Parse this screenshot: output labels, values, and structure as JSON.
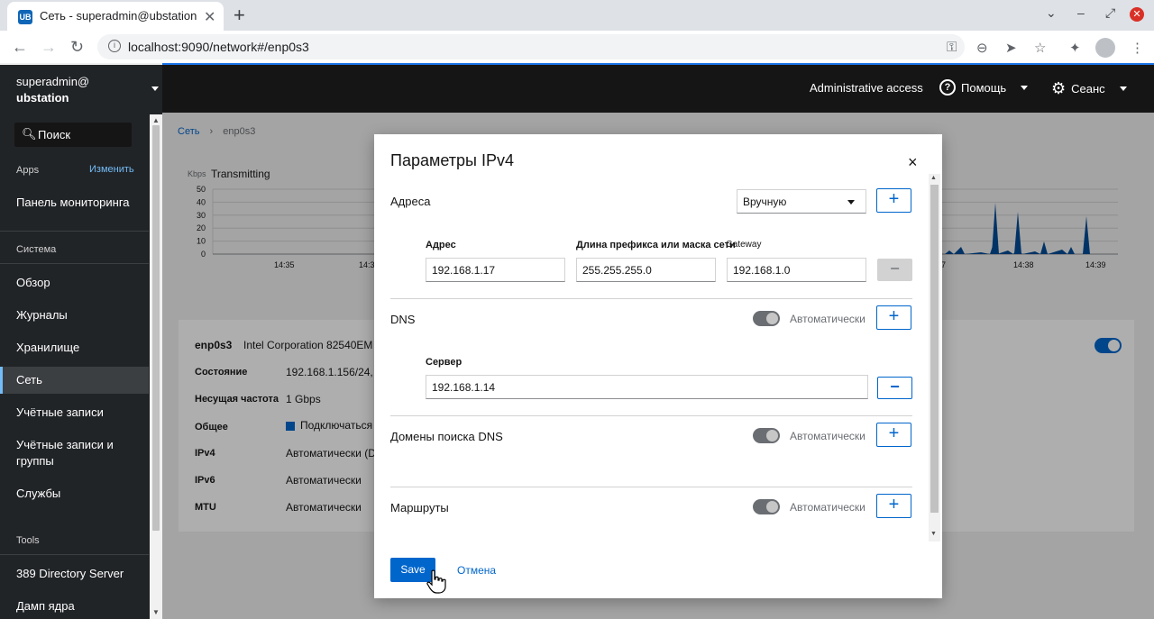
{
  "browser": {
    "tab_title": "Сеть - superadmin@ubstation",
    "favicon_text": "UB",
    "url": "localhost:9090/network#/enp0s3"
  },
  "masthead": {
    "admin_access": "Administrative access",
    "help": "Помощь",
    "session": "Сеанс"
  },
  "sidebar": {
    "user": "superadmin@",
    "host": "ubstation",
    "search_placeholder": "Поиск",
    "apps_label": "Apps",
    "edit_label": "Изменить",
    "dashboard": "Панель мониторинга",
    "system_label": "Система",
    "items": [
      "Обзор",
      "Журналы",
      "Хранилище",
      "Сеть",
      "Учётные записи",
      "Учётные записи и группы",
      "Службы"
    ],
    "tools_label": "Tools",
    "tools": [
      "389 Directory Server",
      "Дамп ядра"
    ]
  },
  "page": {
    "breadcrumb_root": "Сеть",
    "breadcrumb_current": "enp0s3",
    "chart_unit": "Kbps",
    "chart_title": "Transmitting",
    "chart_yticks": [
      "50",
      "40",
      "30",
      "20",
      "10",
      "0"
    ],
    "chart_xticks_left": [
      "14:35",
      "14:3"
    ],
    "chart_xticks_right": [
      "7",
      "14:38",
      "14:39"
    ],
    "iface_name": "enp0s3",
    "iface_vendor": "Intel Corporation 82540EM",
    "rows": [
      {
        "label": "Состояние",
        "value": "192.168.1.156/24, fe"
      },
      {
        "label": "Несущая частота",
        "value": "1 Gbps"
      },
      {
        "label": "Общее",
        "value": "Подключаться"
      },
      {
        "label": "IPv4",
        "value": "Автоматически (D"
      },
      {
        "label": "IPv6",
        "value": "Автоматически"
      },
      {
        "label": "MTU",
        "value": "Автоматически"
      }
    ]
  },
  "modal": {
    "title": "Параметры IPv4",
    "addresses_label": "Адреса",
    "mode_value": "Вручную",
    "col_address": "Адрес",
    "col_prefix": "Длина префикса или маска сети",
    "col_gateway": "Gateway",
    "address_value": "192.168.1.17",
    "prefix_value": "255.255.255.0",
    "gateway_value": "192.168.1.0",
    "dns_label": "DNS",
    "auto_label": "Автоматически",
    "server_label": "Сервер",
    "server_value": "192.168.1.14",
    "dns_search_label": "Домены поиска DNS",
    "routes_label": "Маршруты",
    "save_label": "Save",
    "cancel_label": "Отмена"
  },
  "icons": {
    "plus": "+",
    "minus": "−",
    "close": "×"
  },
  "colors": {
    "accent": "#0066cc",
    "masthead": "#151515",
    "sidebar": "#212427",
    "chart_fill": "#004b95"
  }
}
